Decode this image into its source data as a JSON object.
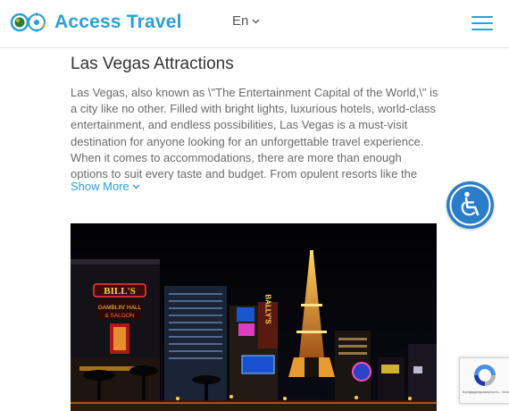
{
  "header": {
    "brand": "Access Travel",
    "language": "En"
  },
  "article": {
    "title": "Las Vegas Attractions",
    "description": "Las Vegas, also known as \\\"The Entertainment Capital of the World,\\\" is a city like no other. Filled with bright lights, luxurious hotels, world-class entertainment, and endless possibilities, Las Vegas is a must-visit destination for anyone looking for an unforgettable travel experience. When it comes to accommodations, there are more than enough options to suit every taste and budget. From opulent resorts like the",
    "show_more": "Show More"
  },
  "hero_image": {
    "signs": {
      "gambling_top": "BILL'S",
      "gambling_mid": "GAMBLIN' HALL",
      "gambling_bot": "& SALOON",
      "ballys": "BALLY'S"
    }
  },
  "recaptcha": {
    "text": "Конфиденциальность - Условия использования"
  },
  "colors": {
    "brand_blue": "#2a9fd8",
    "accessibility_blue": "#2a7dc8",
    "text_gray": "#6a6a6a",
    "title_dark": "#333333"
  },
  "icons": {
    "logo": "globe-logo-icon",
    "language_chevron": "chevron-down-icon",
    "menu": "hamburger-menu-icon",
    "show_more_chevron": "chevron-down-icon",
    "accessibility": "wheelchair-icon",
    "recaptcha": "recaptcha-icon"
  }
}
